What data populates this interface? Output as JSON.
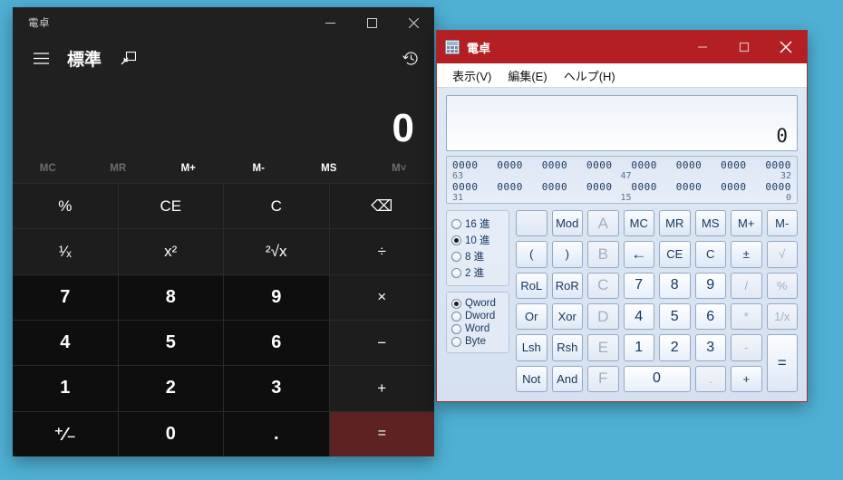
{
  "desktop": {
    "background_color": "#4fb0d4"
  },
  "modern_calculator": {
    "window_title": "電卓",
    "titlebar_buttons": {
      "minimize": "minimize-icon",
      "maximize": "maximize-icon",
      "close": "close-icon"
    },
    "nav": {
      "menu_icon": "hamburger-icon",
      "mode_label": "標準",
      "keep_on_top_icon": "keep-on-top-icon",
      "history_icon": "history-icon"
    },
    "display": {
      "result": "0"
    },
    "memory_buttons": [
      {
        "label": "MC",
        "enabled": false
      },
      {
        "label": "MR",
        "enabled": false
      },
      {
        "label": "M+",
        "enabled": true
      },
      {
        "label": "M-",
        "enabled": true
      },
      {
        "label": "MS",
        "enabled": true
      },
      {
        "label": "M˅",
        "enabled": false
      }
    ],
    "keys": [
      {
        "label": "%",
        "kind": "op"
      },
      {
        "label": "CE",
        "kind": "op"
      },
      {
        "label": "C",
        "kind": "op"
      },
      {
        "label": "⌫",
        "kind": "op"
      },
      {
        "label": "¹⁄ₓ",
        "kind": "op"
      },
      {
        "label": "x²",
        "kind": "op"
      },
      {
        "label": "²√x",
        "kind": "op"
      },
      {
        "label": "÷",
        "kind": "op"
      },
      {
        "label": "7",
        "kind": "num"
      },
      {
        "label": "8",
        "kind": "num"
      },
      {
        "label": "9",
        "kind": "num"
      },
      {
        "label": "×",
        "kind": "op"
      },
      {
        "label": "4",
        "kind": "num"
      },
      {
        "label": "5",
        "kind": "num"
      },
      {
        "label": "6",
        "kind": "num"
      },
      {
        "label": "−",
        "kind": "op"
      },
      {
        "label": "1",
        "kind": "num"
      },
      {
        "label": "2",
        "kind": "num"
      },
      {
        "label": "3",
        "kind": "num"
      },
      {
        "label": "+",
        "kind": "op"
      },
      {
        "label": "⁺⁄₋",
        "kind": "num"
      },
      {
        "label": "0",
        "kind": "num"
      },
      {
        "label": ".",
        "kind": "num"
      },
      {
        "label": "=",
        "kind": "eq"
      }
    ],
    "equals_color": "#5e2222"
  },
  "classic_calculator": {
    "window_title": "電卓",
    "titlebar_color": "#b41f24",
    "app_icon": "calculator-icon",
    "titlebar_buttons": {
      "minimize": "minimize-icon",
      "maximize": "maximize-icon",
      "close": "close-icon"
    },
    "menus": [
      "表示(V)",
      "編集(E)",
      "ヘルプ(H)"
    ],
    "display": {
      "value": "0"
    },
    "bit_display": {
      "row1_groups": [
        "0000",
        "0000",
        "0000",
        "0000",
        "0000",
        "0000",
        "0000",
        "0000"
      ],
      "row1_labels": {
        "left": "63",
        "middle": "47",
        "right": "32"
      },
      "row2_groups": [
        "0000",
        "0000",
        "0000",
        "0000",
        "0000",
        "0000",
        "0000",
        "0000"
      ],
      "row2_labels": {
        "left": "31",
        "middle": "15",
        "right": "0"
      }
    },
    "base_options": [
      {
        "label": "16 進",
        "selected": false
      },
      {
        "label": "10 進",
        "selected": true
      },
      {
        "label": "8 進",
        "selected": false
      },
      {
        "label": "2 進",
        "selected": false
      }
    ],
    "word_options": [
      {
        "label": "Qword",
        "selected": true
      },
      {
        "label": "Dword",
        "selected": false
      },
      {
        "label": "Word",
        "selected": false
      },
      {
        "label": "Byte",
        "selected": false
      }
    ],
    "keys": [
      {
        "label": "",
        "kind": "blank"
      },
      {
        "label": "Mod",
        "kind": "fn"
      },
      {
        "label": "A",
        "kind": "hex-disabled"
      },
      {
        "label": "MC",
        "kind": "fn"
      },
      {
        "label": "MR",
        "kind": "fn"
      },
      {
        "label": "MS",
        "kind": "fn"
      },
      {
        "label": "M+",
        "kind": "fn"
      },
      {
        "label": "M-",
        "kind": "fn"
      },
      {
        "label": "(",
        "kind": "fn"
      },
      {
        "label": ")",
        "kind": "fn"
      },
      {
        "label": "B",
        "kind": "hex-disabled"
      },
      {
        "label": "←",
        "kind": "fn"
      },
      {
        "label": "CE",
        "kind": "fn"
      },
      {
        "label": "C",
        "kind": "fn"
      },
      {
        "label": "±",
        "kind": "fn"
      },
      {
        "label": "√",
        "kind": "disabled"
      },
      {
        "label": "RoL",
        "kind": "fn"
      },
      {
        "label": "RoR",
        "kind": "fn"
      },
      {
        "label": "C",
        "kind": "hex-disabled"
      },
      {
        "label": "7",
        "kind": "num"
      },
      {
        "label": "8",
        "kind": "num"
      },
      {
        "label": "9",
        "kind": "num"
      },
      {
        "label": "/",
        "kind": "disabled"
      },
      {
        "label": "%",
        "kind": "disabled"
      },
      {
        "label": "Or",
        "kind": "fn"
      },
      {
        "label": "Xor",
        "kind": "fn"
      },
      {
        "label": "D",
        "kind": "hex-disabled"
      },
      {
        "label": "4",
        "kind": "num"
      },
      {
        "label": "5",
        "kind": "num"
      },
      {
        "label": "6",
        "kind": "num"
      },
      {
        "label": "*",
        "kind": "disabled"
      },
      {
        "label": "1/x",
        "kind": "disabled"
      },
      {
        "label": "Lsh",
        "kind": "fn"
      },
      {
        "label": "Rsh",
        "kind": "fn"
      },
      {
        "label": "E",
        "kind": "hex-disabled"
      },
      {
        "label": "1",
        "kind": "num"
      },
      {
        "label": "2",
        "kind": "num"
      },
      {
        "label": "3",
        "kind": "num"
      },
      {
        "label": "-",
        "kind": "disabled"
      },
      {
        "label": "=",
        "kind": "equals"
      },
      {
        "label": "Not",
        "kind": "fn"
      },
      {
        "label": "And",
        "kind": "fn"
      },
      {
        "label": "F",
        "kind": "hex-disabled"
      },
      {
        "label": "0",
        "kind": "num-wide"
      },
      {
        "label": ".",
        "kind": "disabled"
      },
      {
        "label": "+",
        "kind": "fn"
      }
    ]
  }
}
